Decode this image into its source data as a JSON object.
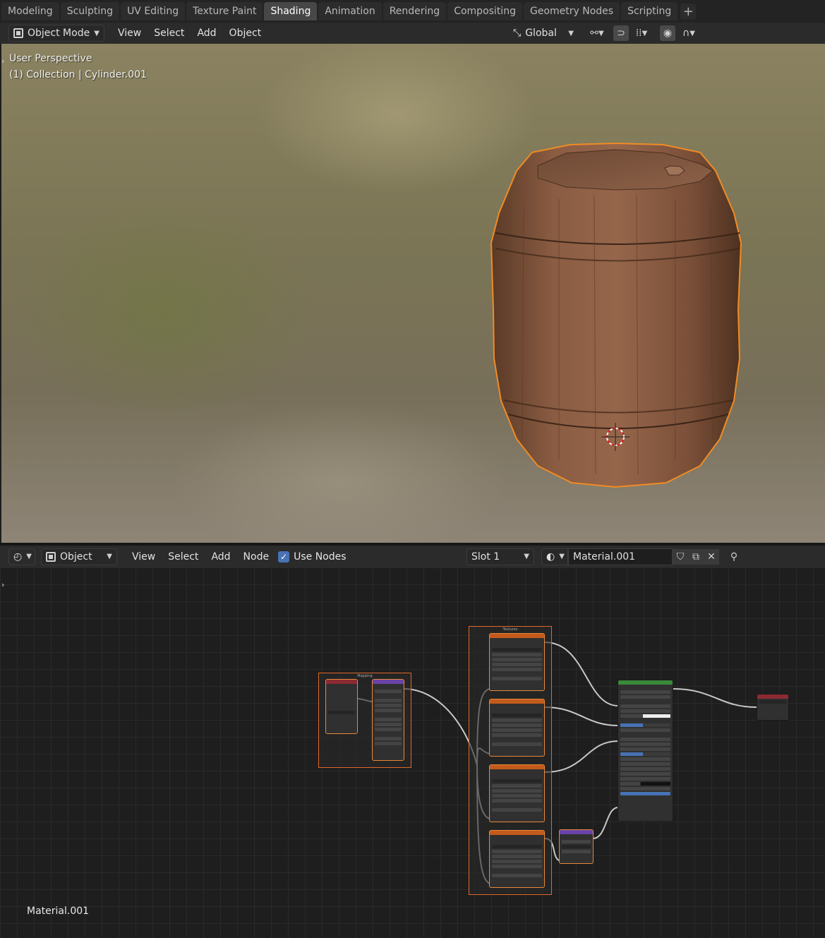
{
  "workspace_tabs": [
    "Modeling",
    "Sculpting",
    "UV Editing",
    "Texture Paint",
    "Shading",
    "Animation",
    "Rendering",
    "Compositing",
    "Geometry Nodes",
    "Scripting"
  ],
  "active_workspace": "Shading",
  "viewport_header": {
    "mode": "Object Mode",
    "menus": [
      "View",
      "Select",
      "Add",
      "Object"
    ],
    "transform_orientation": "Global"
  },
  "viewport": {
    "perspective_label": "User Perspective",
    "collection_label": "(1) Collection | Cylinder.001"
  },
  "node_header": {
    "editor_type_icon": "node-editor-icon",
    "shader_type": "Object",
    "menus": [
      "View",
      "Select",
      "Add",
      "Node"
    ],
    "use_nodes_label": "Use Nodes",
    "use_nodes_checked": true,
    "slot": "Slot 1",
    "material_name": "Material.001"
  },
  "node_editor": {
    "material_label": "Material.001"
  },
  "colors": {
    "accent": "#4772b3",
    "selection": "#e0682a",
    "header_bg": "#2b2b2b"
  }
}
